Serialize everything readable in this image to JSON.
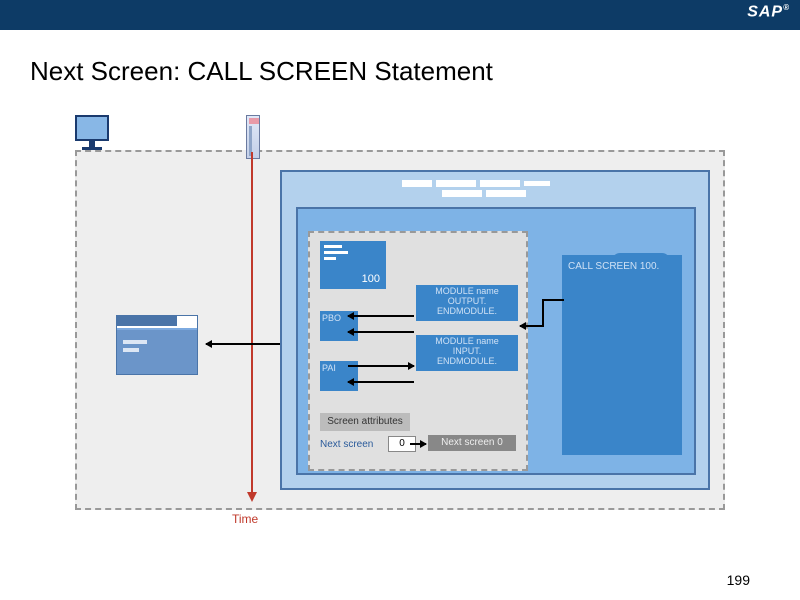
{
  "header": {
    "logo": "SAP"
  },
  "title": "Next Screen: CALL SCREEN Statement",
  "time_label": "Time",
  "screen_number": "100",
  "pbo_label": "PBO",
  "pai_label": "PAI",
  "module_output": "MODULE name\n  OUTPUT.\nENDMODULE.",
  "module_input": "MODULE name\n  INPUT.\nENDMODULE.",
  "screen_attr_label": "Screen attributes",
  "next_screen_label": "Next screen",
  "next_screen_value": "0",
  "next_screen_tag": "Next screen 0",
  "call_screen": "CALL SCREEN 100.",
  "page_number": "199"
}
